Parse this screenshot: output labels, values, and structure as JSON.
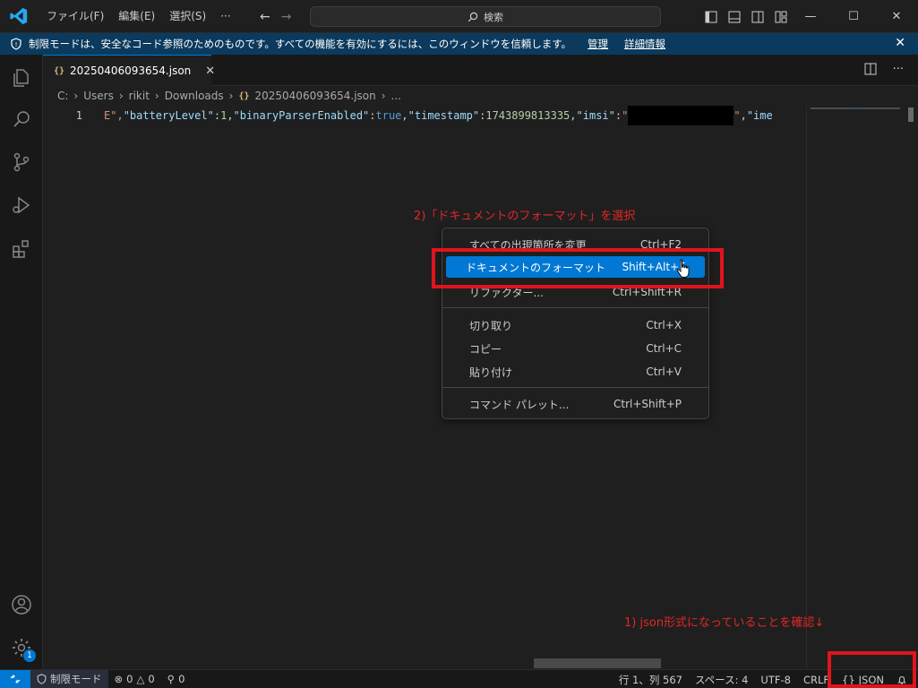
{
  "titlebar": {
    "menu": [
      "ファイル(F)",
      "編集(E)",
      "選択(S)",
      "···"
    ],
    "search_placeholder": "検索"
  },
  "banner": {
    "message": "制限モードは、安全なコード参照のためのものです。すべての機能を有効にするには、このウィンドウを信頼します。",
    "manage_link": "管理",
    "details_link": "詳細情報"
  },
  "tab": {
    "icon_text": "{}",
    "filename": "20250406093654.json"
  },
  "breadcrumb": {
    "parts": [
      "C:",
      "Users",
      "rikit",
      "Downloads"
    ],
    "file": "20250406093654.json",
    "tail": "..."
  },
  "editor": {
    "line_number": "1",
    "code": {
      "p1": "E\",",
      "k1": "\"batteryLevel\"",
      "c1": ":",
      "v1": "1",
      "comma1": ",",
      "k2": "\"binaryParserEnabled\"",
      "c2": ":",
      "v2": "true",
      "comma2": ",",
      "k3": "\"timestamp\"",
      "c3": ":",
      "v3": "1743899813335",
      "comma3": ",",
      "k4": "\"imsi\"",
      "c4": ":",
      "q1": "\"",
      "q2": "\"",
      "comma4": ",",
      "k5": "\"ime"
    }
  },
  "annotations": {
    "step2": "2)「ドキュメントのフォーマット」を選択",
    "step1": "1) json形式になっていることを確認↓"
  },
  "context_menu": {
    "items": [
      {
        "label": "すべての出現箇所を変更",
        "shortcut": "Ctrl+F2"
      },
      {
        "label": "ドキュメントのフォーマット",
        "shortcut": "Shift+Alt+F"
      },
      {
        "label": "リファクター...",
        "shortcut": "Ctrl+Shift+R"
      },
      {
        "label": "切り取り",
        "shortcut": "Ctrl+X"
      },
      {
        "label": "コピー",
        "shortcut": "Ctrl+C"
      },
      {
        "label": "貼り付け",
        "shortcut": "Ctrl+V"
      },
      {
        "label": "コマンド パレット...",
        "shortcut": "Ctrl+Shift+P"
      }
    ]
  },
  "statusbar": {
    "restricted": "制限モード",
    "errors": "0",
    "warnings": "0",
    "ports": "0",
    "position": "行 1、列 567",
    "spaces": "スペース: 4",
    "encoding": "UTF-8",
    "eol": "CRLF",
    "language_icon": "{}",
    "language": "JSON"
  },
  "activity_badge": "1",
  "colors": {
    "accent": "#0078d4",
    "annotation_red": "#e32626",
    "banner_bg": "#0b3a5e"
  }
}
